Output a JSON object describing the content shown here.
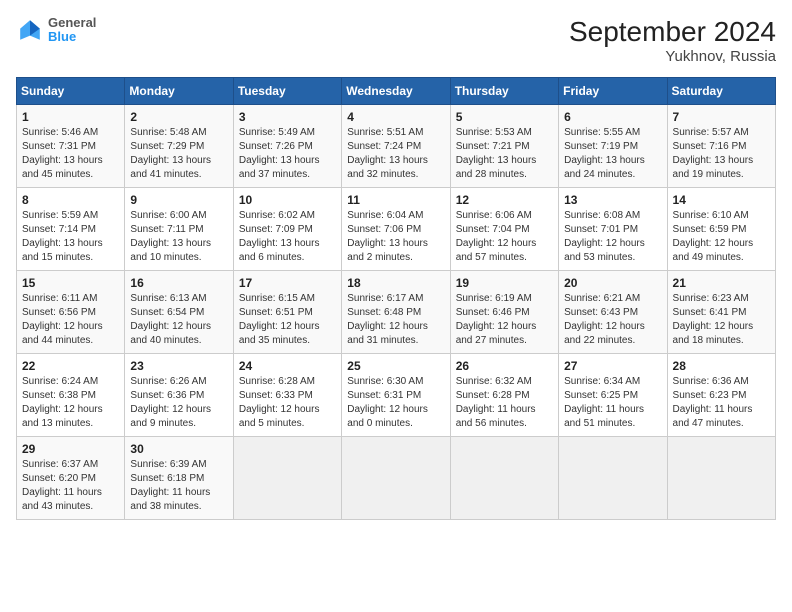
{
  "header": {
    "logo_line1": "General",
    "logo_line2": "Blue",
    "title": "September 2024",
    "subtitle": "Yukhnov, Russia"
  },
  "calendar": {
    "headers": [
      "Sunday",
      "Monday",
      "Tuesday",
      "Wednesday",
      "Thursday",
      "Friday",
      "Saturday"
    ],
    "weeks": [
      [
        null,
        {
          "day": "2",
          "sunrise": "5:48 AM",
          "sunset": "7:29 PM",
          "daylight": "13 hours and 41 minutes."
        },
        {
          "day": "3",
          "sunrise": "5:49 AM",
          "sunset": "7:26 PM",
          "daylight": "13 hours and 37 minutes."
        },
        {
          "day": "4",
          "sunrise": "5:51 AM",
          "sunset": "7:24 PM",
          "daylight": "13 hours and 32 minutes."
        },
        {
          "day": "5",
          "sunrise": "5:53 AM",
          "sunset": "7:21 PM",
          "daylight": "13 hours and 28 minutes."
        },
        {
          "day": "6",
          "sunrise": "5:55 AM",
          "sunset": "7:19 PM",
          "daylight": "13 hours and 24 minutes."
        },
        {
          "day": "7",
          "sunrise": "5:57 AM",
          "sunset": "7:16 PM",
          "daylight": "13 hours and 19 minutes."
        }
      ],
      [
        {
          "day": "1",
          "sunrise": "5:46 AM",
          "sunset": "7:31 PM",
          "daylight": "13 hours and 45 minutes."
        },
        {
          "day": "9",
          "sunrise": "6:00 AM",
          "sunset": "7:11 PM",
          "daylight": "13 hours and 10 minutes."
        },
        {
          "day": "10",
          "sunrise": "6:02 AM",
          "sunset": "7:09 PM",
          "daylight": "13 hours and 6 minutes."
        },
        {
          "day": "11",
          "sunrise": "6:04 AM",
          "sunset": "7:06 PM",
          "daylight": "13 hours and 2 minutes."
        },
        {
          "day": "12",
          "sunrise": "6:06 AM",
          "sunset": "7:04 PM",
          "daylight": "12 hours and 57 minutes."
        },
        {
          "day": "13",
          "sunrise": "6:08 AM",
          "sunset": "7:01 PM",
          "daylight": "12 hours and 53 minutes."
        },
        {
          "day": "14",
          "sunrise": "6:10 AM",
          "sunset": "6:59 PM",
          "daylight": "12 hours and 49 minutes."
        }
      ],
      [
        {
          "day": "8",
          "sunrise": "5:59 AM",
          "sunset": "7:14 PM",
          "daylight": "13 hours and 15 minutes."
        },
        {
          "day": "16",
          "sunrise": "6:13 AM",
          "sunset": "6:54 PM",
          "daylight": "12 hours and 40 minutes."
        },
        {
          "day": "17",
          "sunrise": "6:15 AM",
          "sunset": "6:51 PM",
          "daylight": "12 hours and 35 minutes."
        },
        {
          "day": "18",
          "sunrise": "6:17 AM",
          "sunset": "6:48 PM",
          "daylight": "12 hours and 31 minutes."
        },
        {
          "day": "19",
          "sunrise": "6:19 AM",
          "sunset": "6:46 PM",
          "daylight": "12 hours and 27 minutes."
        },
        {
          "day": "20",
          "sunrise": "6:21 AM",
          "sunset": "6:43 PM",
          "daylight": "12 hours and 22 minutes."
        },
        {
          "day": "21",
          "sunrise": "6:23 AM",
          "sunset": "6:41 PM",
          "daylight": "12 hours and 18 minutes."
        }
      ],
      [
        {
          "day": "15",
          "sunrise": "6:11 AM",
          "sunset": "6:56 PM",
          "daylight": "12 hours and 44 minutes."
        },
        {
          "day": "23",
          "sunrise": "6:26 AM",
          "sunset": "6:36 PM",
          "daylight": "12 hours and 9 minutes."
        },
        {
          "day": "24",
          "sunrise": "6:28 AM",
          "sunset": "6:33 PM",
          "daylight": "12 hours and 5 minutes."
        },
        {
          "day": "25",
          "sunrise": "6:30 AM",
          "sunset": "6:31 PM",
          "daylight": "12 hours and 0 minutes."
        },
        {
          "day": "26",
          "sunrise": "6:32 AM",
          "sunset": "6:28 PM",
          "daylight": "11 hours and 56 minutes."
        },
        {
          "day": "27",
          "sunrise": "6:34 AM",
          "sunset": "6:25 PM",
          "daylight": "11 hours and 51 minutes."
        },
        {
          "day": "28",
          "sunrise": "6:36 AM",
          "sunset": "6:23 PM",
          "daylight": "11 hours and 47 minutes."
        }
      ],
      [
        {
          "day": "22",
          "sunrise": "6:24 AM",
          "sunset": "6:38 PM",
          "daylight": "12 hours and 13 minutes."
        },
        {
          "day": "30",
          "sunrise": "6:39 AM",
          "sunset": "6:18 PM",
          "daylight": "11 hours and 38 minutes."
        },
        null,
        null,
        null,
        null,
        null
      ],
      [
        {
          "day": "29",
          "sunrise": "6:37 AM",
          "sunset": "6:20 PM",
          "daylight": "11 hours and 43 minutes."
        },
        null,
        null,
        null,
        null,
        null,
        null
      ]
    ]
  }
}
